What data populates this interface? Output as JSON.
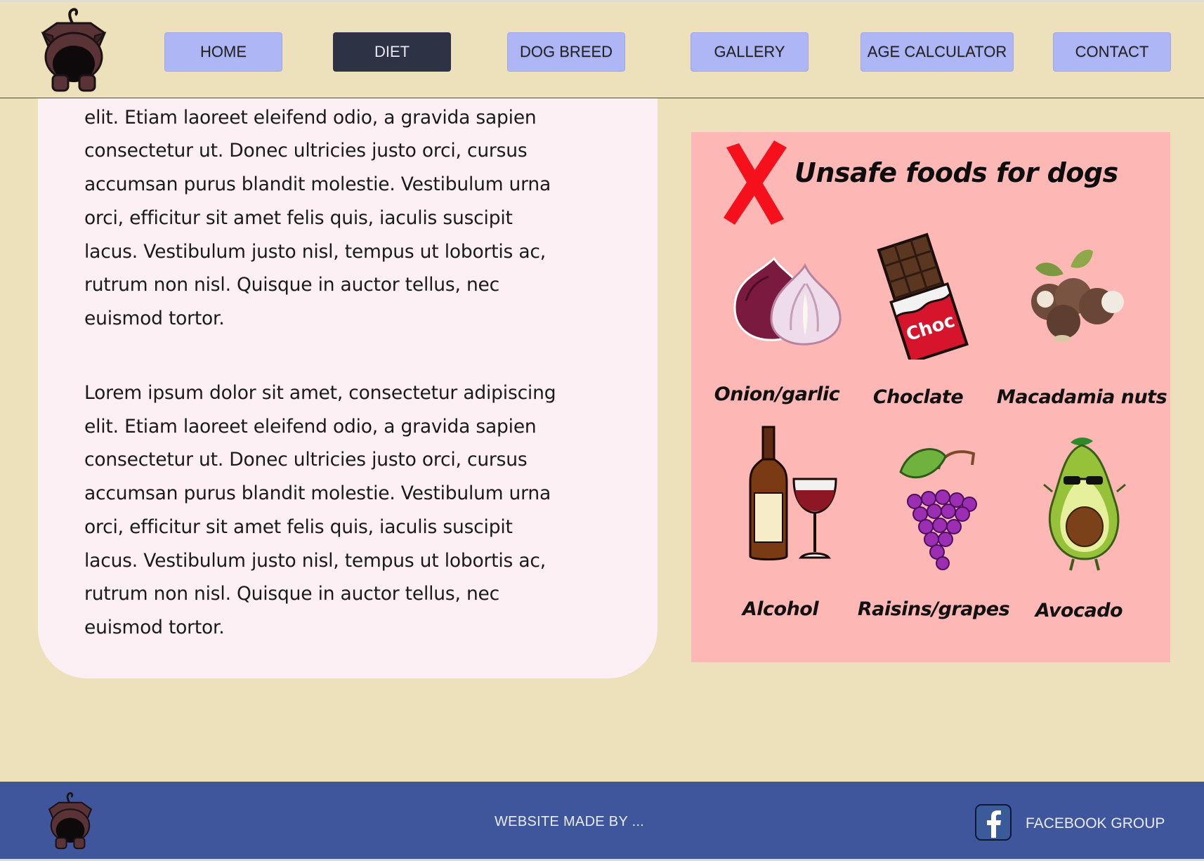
{
  "nav": {
    "items": [
      {
        "label": "HOME"
      },
      {
        "label": "DIET"
      },
      {
        "label": "DOG BREED"
      },
      {
        "label": "GALLERY"
      },
      {
        "label": "AGE CALCULATOR"
      },
      {
        "label": "CONTACT"
      }
    ],
    "active": "DIET"
  },
  "content": {
    "paragraph_1": "Lorem ipsum dolor sit amet, consectetur adipiscing elit. Etiam laoreet eleifend odio, a gravida sapien consectetur ut. Donec ultricies justo orci, cursus accumsan purus blandit molestie. Vestibulum urna orci, efficitur sit amet felis quis, iaculis suscipit lacus. Vestibulum justo nisl, tempus ut lobortis ac, rutrum non nisl. Quisque in auctor tellus, nec euismod tortor.",
    "paragraph_2": "Lorem ipsum dolor sit amet, consectetur adipiscing elit. Etiam laoreet eleifend odio, a gravida sapien consectetur ut. Donec ultricies justo orci, cursus accumsan purus blandit molestie. Vestibulum urna orci, efficitur sit amet felis quis, iaculis suscipit lacus. Vestibulum justo nisl, tempus ut lobortis ac, rutrum non nisl. Quisque in auctor tellus, nec euismod tortor."
  },
  "unsafe_foods": {
    "title": "Unsafe foods for dogs",
    "items": [
      {
        "label": "Onion/garlic",
        "icon": "onion-icon"
      },
      {
        "label": "Choclate",
        "icon": "chocolate-icon",
        "wrapper_text": "Choc"
      },
      {
        "label": "Macadamia nuts",
        "icon": "macadamia-icon"
      },
      {
        "label": "Alcohol",
        "icon": "wine-icon"
      },
      {
        "label": "Raisins/grapes",
        "icon": "grapes-icon"
      },
      {
        "label": "Avocado",
        "icon": "avocado-icon"
      }
    ]
  },
  "footer": {
    "credit": "WEBSITE MADE BY ...",
    "facebook_label": "FACEBOOK GROUP"
  },
  "colors": {
    "page_bg": "#ede1bb",
    "nav_button": "#aeb6f6",
    "nav_active": "#2d3244",
    "text_card": "#fcf0f5",
    "unsafe_panel": "#fdb8b6",
    "footer_bg": "#3f559c"
  }
}
